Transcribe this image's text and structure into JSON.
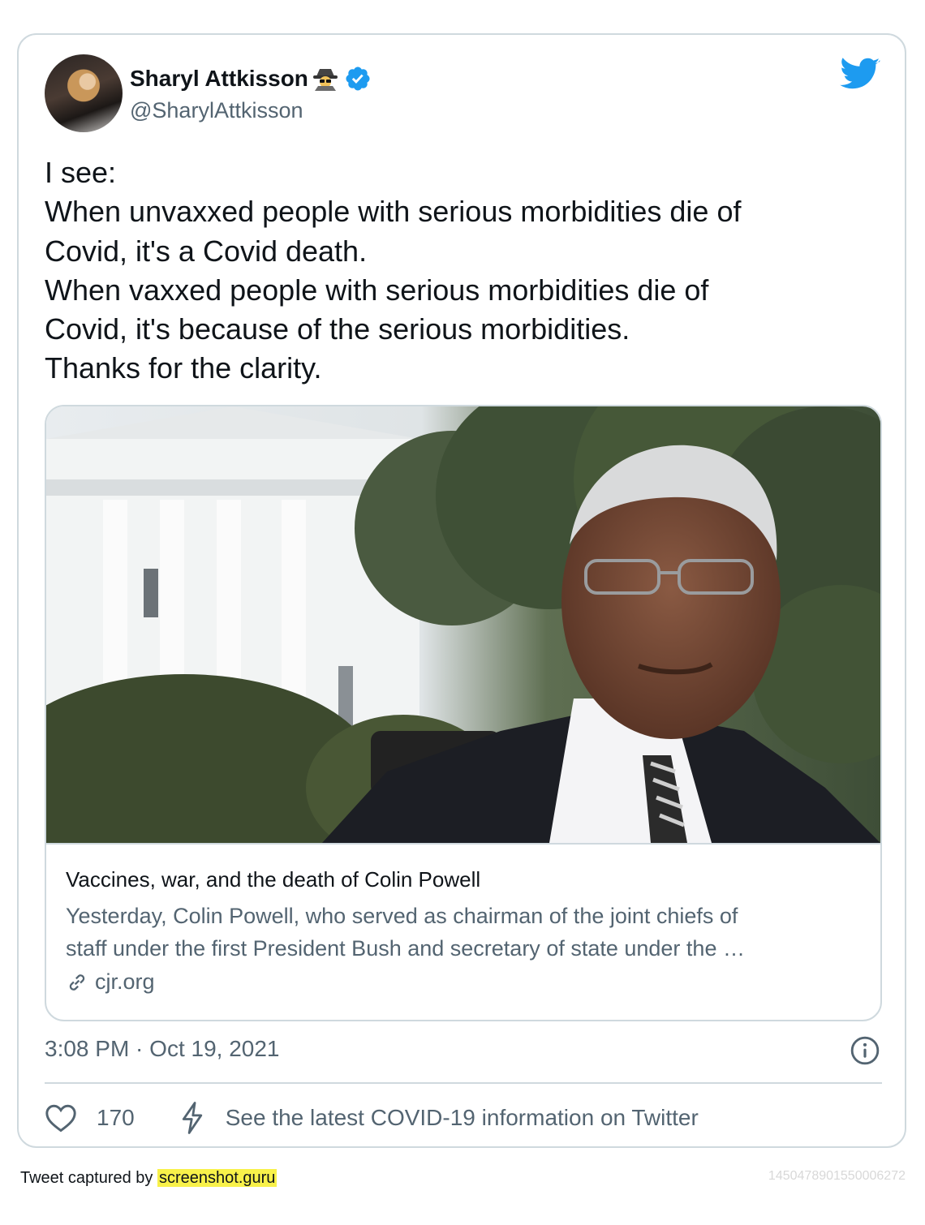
{
  "tweet": {
    "display_name": "Sharyl Attkisson",
    "name_emoji": "sleuth-spy-emoji",
    "verified": true,
    "handle": "@SharylAttkisson",
    "text_lines": [
      "I see:",
      "When unvaxxed people with serious morbidities die of",
      "Covid, it's a Covid death.",
      "When vaxxed people with serious morbidities die of",
      "Covid, it's because of the serious morbidities.",
      "Thanks for the clarity."
    ],
    "link_card": {
      "image": "photo-colin-powell-white-house",
      "title": "Vaccines, war, and the death of Colin Powell",
      "description_lines": [
        "Yesterday, Colin Powell, who served as chairman of the joint chiefs of",
        "staff under the first President Bush and secretary of state under the …"
      ],
      "domain": "cjr.org"
    },
    "timestamp": "3:08 PM · Oct 19, 2021",
    "like_count": "170",
    "covid_link_text": "See the latest COVID-19 information on Twitter"
  },
  "footer": {
    "captured_by": "Tweet captured by ",
    "brand": "screenshot.guru",
    "tweet_id": "1450478901550006272"
  },
  "colors": {
    "twitter_blue": "#1d9bf0",
    "secondary_text": "#536471",
    "border": "#cfd9de",
    "highlight": "#f8f14a"
  }
}
